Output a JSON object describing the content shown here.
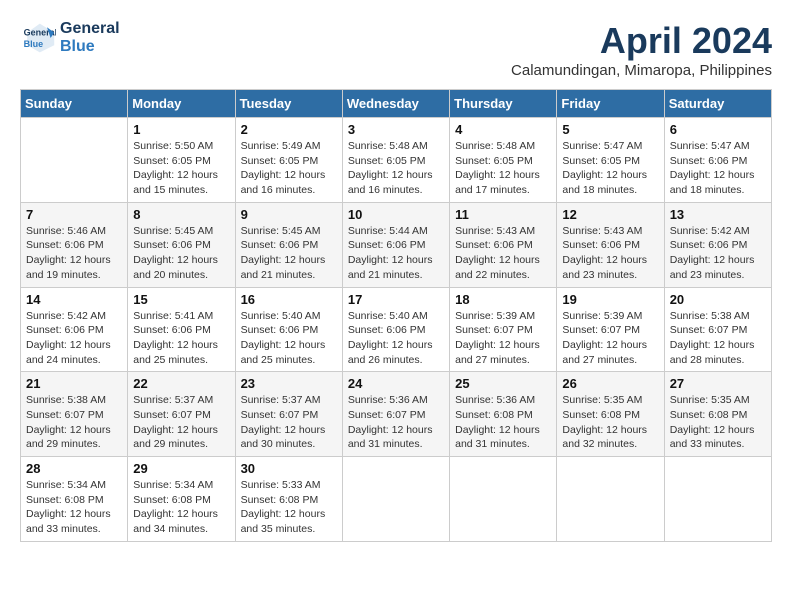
{
  "header": {
    "logo_line1": "General",
    "logo_line2": "Blue",
    "month": "April 2024",
    "location": "Calamundingan, Mimaropa, Philippines"
  },
  "days_of_week": [
    "Sunday",
    "Monday",
    "Tuesday",
    "Wednesday",
    "Thursday",
    "Friday",
    "Saturday"
  ],
  "weeks": [
    [
      {
        "num": "",
        "info": ""
      },
      {
        "num": "1",
        "info": "Sunrise: 5:50 AM\nSunset: 6:05 PM\nDaylight: 12 hours\nand 15 minutes."
      },
      {
        "num": "2",
        "info": "Sunrise: 5:49 AM\nSunset: 6:05 PM\nDaylight: 12 hours\nand 16 minutes."
      },
      {
        "num": "3",
        "info": "Sunrise: 5:48 AM\nSunset: 6:05 PM\nDaylight: 12 hours\nand 16 minutes."
      },
      {
        "num": "4",
        "info": "Sunrise: 5:48 AM\nSunset: 6:05 PM\nDaylight: 12 hours\nand 17 minutes."
      },
      {
        "num": "5",
        "info": "Sunrise: 5:47 AM\nSunset: 6:05 PM\nDaylight: 12 hours\nand 18 minutes."
      },
      {
        "num": "6",
        "info": "Sunrise: 5:47 AM\nSunset: 6:06 PM\nDaylight: 12 hours\nand 18 minutes."
      }
    ],
    [
      {
        "num": "7",
        "info": "Sunrise: 5:46 AM\nSunset: 6:06 PM\nDaylight: 12 hours\nand 19 minutes."
      },
      {
        "num": "8",
        "info": "Sunrise: 5:45 AM\nSunset: 6:06 PM\nDaylight: 12 hours\nand 20 minutes."
      },
      {
        "num": "9",
        "info": "Sunrise: 5:45 AM\nSunset: 6:06 PM\nDaylight: 12 hours\nand 21 minutes."
      },
      {
        "num": "10",
        "info": "Sunrise: 5:44 AM\nSunset: 6:06 PM\nDaylight: 12 hours\nand 21 minutes."
      },
      {
        "num": "11",
        "info": "Sunrise: 5:43 AM\nSunset: 6:06 PM\nDaylight: 12 hours\nand 22 minutes."
      },
      {
        "num": "12",
        "info": "Sunrise: 5:43 AM\nSunset: 6:06 PM\nDaylight: 12 hours\nand 23 minutes."
      },
      {
        "num": "13",
        "info": "Sunrise: 5:42 AM\nSunset: 6:06 PM\nDaylight: 12 hours\nand 23 minutes."
      }
    ],
    [
      {
        "num": "14",
        "info": "Sunrise: 5:42 AM\nSunset: 6:06 PM\nDaylight: 12 hours\nand 24 minutes."
      },
      {
        "num": "15",
        "info": "Sunrise: 5:41 AM\nSunset: 6:06 PM\nDaylight: 12 hours\nand 25 minutes."
      },
      {
        "num": "16",
        "info": "Sunrise: 5:40 AM\nSunset: 6:06 PM\nDaylight: 12 hours\nand 25 minutes."
      },
      {
        "num": "17",
        "info": "Sunrise: 5:40 AM\nSunset: 6:06 PM\nDaylight: 12 hours\nand 26 minutes."
      },
      {
        "num": "18",
        "info": "Sunrise: 5:39 AM\nSunset: 6:07 PM\nDaylight: 12 hours\nand 27 minutes."
      },
      {
        "num": "19",
        "info": "Sunrise: 5:39 AM\nSunset: 6:07 PM\nDaylight: 12 hours\nand 27 minutes."
      },
      {
        "num": "20",
        "info": "Sunrise: 5:38 AM\nSunset: 6:07 PM\nDaylight: 12 hours\nand 28 minutes."
      }
    ],
    [
      {
        "num": "21",
        "info": "Sunrise: 5:38 AM\nSunset: 6:07 PM\nDaylight: 12 hours\nand 29 minutes."
      },
      {
        "num": "22",
        "info": "Sunrise: 5:37 AM\nSunset: 6:07 PM\nDaylight: 12 hours\nand 29 minutes."
      },
      {
        "num": "23",
        "info": "Sunrise: 5:37 AM\nSunset: 6:07 PM\nDaylight: 12 hours\nand 30 minutes."
      },
      {
        "num": "24",
        "info": "Sunrise: 5:36 AM\nSunset: 6:07 PM\nDaylight: 12 hours\nand 31 minutes."
      },
      {
        "num": "25",
        "info": "Sunrise: 5:36 AM\nSunset: 6:08 PM\nDaylight: 12 hours\nand 31 minutes."
      },
      {
        "num": "26",
        "info": "Sunrise: 5:35 AM\nSunset: 6:08 PM\nDaylight: 12 hours\nand 32 minutes."
      },
      {
        "num": "27",
        "info": "Sunrise: 5:35 AM\nSunset: 6:08 PM\nDaylight: 12 hours\nand 33 minutes."
      }
    ],
    [
      {
        "num": "28",
        "info": "Sunrise: 5:34 AM\nSunset: 6:08 PM\nDaylight: 12 hours\nand 33 minutes."
      },
      {
        "num": "29",
        "info": "Sunrise: 5:34 AM\nSunset: 6:08 PM\nDaylight: 12 hours\nand 34 minutes."
      },
      {
        "num": "30",
        "info": "Sunrise: 5:33 AM\nSunset: 6:08 PM\nDaylight: 12 hours\nand 35 minutes."
      },
      {
        "num": "",
        "info": ""
      },
      {
        "num": "",
        "info": ""
      },
      {
        "num": "",
        "info": ""
      },
      {
        "num": "",
        "info": ""
      }
    ]
  ]
}
